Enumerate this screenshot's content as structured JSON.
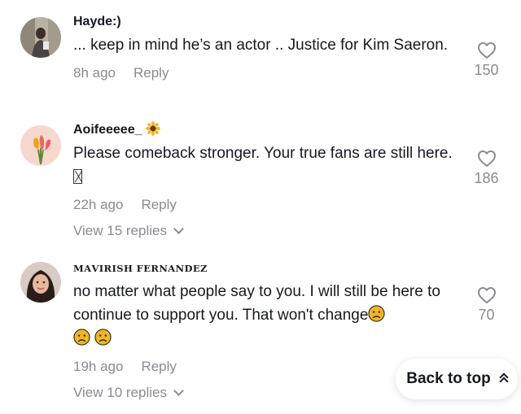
{
  "comments": [
    {
      "username": "Hayde:)",
      "text": "... keep in mind he’s an actor .. Justice for Kim Saeron.",
      "time": "8h ago",
      "reply_label": "Reply",
      "likes": "150"
    },
    {
      "username": "Aoifeeeee_",
      "username_emoji": "sunflower-icon",
      "text": "Please comeback stronger. Your true fans are still here.",
      "text_glyph": "missing-glyph-box",
      "time": "22h ago",
      "reply_label": "Reply",
      "view_replies": "View 15 replies",
      "likes": "186"
    },
    {
      "username": "𝐌𝐀𝐕𝐈𝐑𝐈𝐒𝐇 𝐅𝐄𝐑𝐍𝐀𝐍𝐃𝐄𝐙",
      "text": "no matter what people say to you. I will still be here to continue to support you. That won't change",
      "text_emojis": [
        "frowning-face-icon",
        "frowning-face-icon",
        "frowning-face-icon"
      ],
      "time": "19h ago",
      "reply_label": "Reply",
      "view_replies": "View 10 replies",
      "likes": "70"
    }
  ],
  "back_to_top": {
    "label": "Back to top"
  },
  "colors": {
    "text": "#161823",
    "muted": "#8a8b91",
    "emoji_face": "#f2b622"
  }
}
